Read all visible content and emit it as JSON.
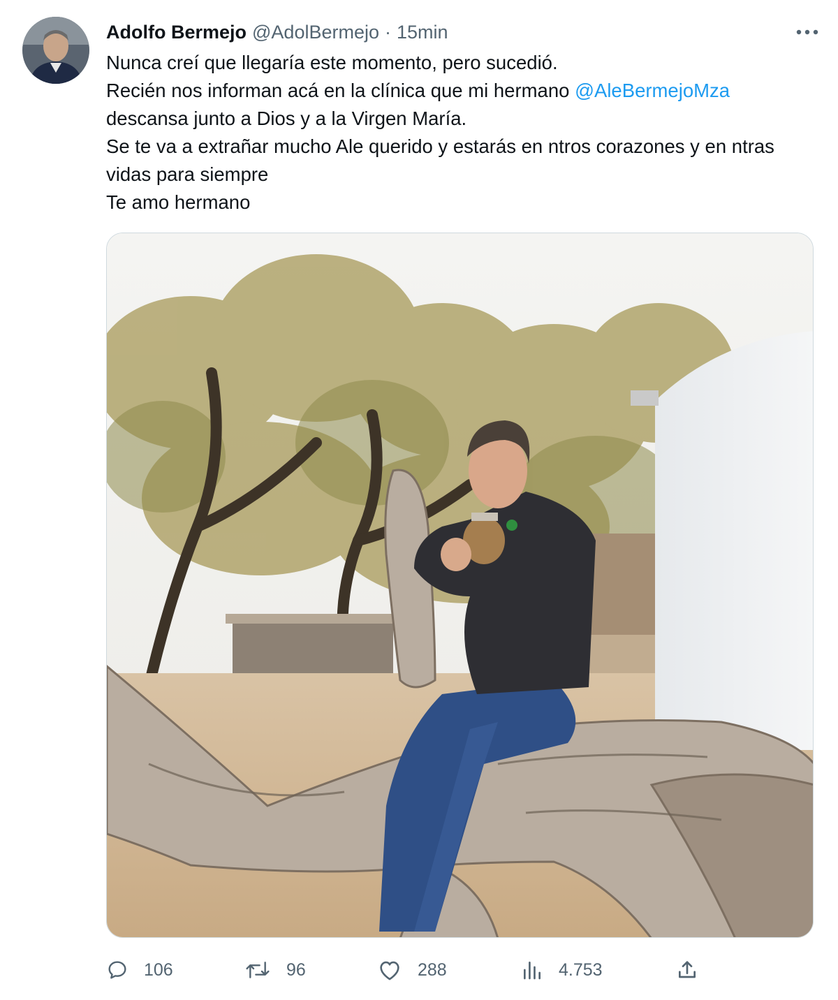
{
  "author": {
    "name": "Adolfo Bermejo",
    "handle": "@AdolBermejo",
    "separator": "·",
    "time": "15min"
  },
  "tweet": {
    "line1": "Nunca creí que llegaría este momento, pero sucedió.",
    "line2_prefix": "Recién nos informan acá en la clínica que mi hermano ",
    "mention": "@AleBermejoMza",
    "line3": "descansa junto a Dios y a la Virgen María.",
    "line4": "Se te va a extrañar mucho Ale querido y estarás en ntros corazones y en ntras vidas para siempre",
    "line5": "Te amo hermano"
  },
  "actions": {
    "replies": "106",
    "retweets": "96",
    "likes": "288",
    "views": "4.753"
  },
  "icons": {
    "more": "more-dots-icon",
    "reply": "reply-bubble-icon",
    "retweet": "retweet-icon",
    "like": "heart-icon",
    "views": "views-bar-chart-icon",
    "share": "share-upload-icon"
  },
  "colors": {
    "text": "#0f1419",
    "secondary": "#536471",
    "link": "#1d9bf0",
    "border": "#cfd9de"
  }
}
